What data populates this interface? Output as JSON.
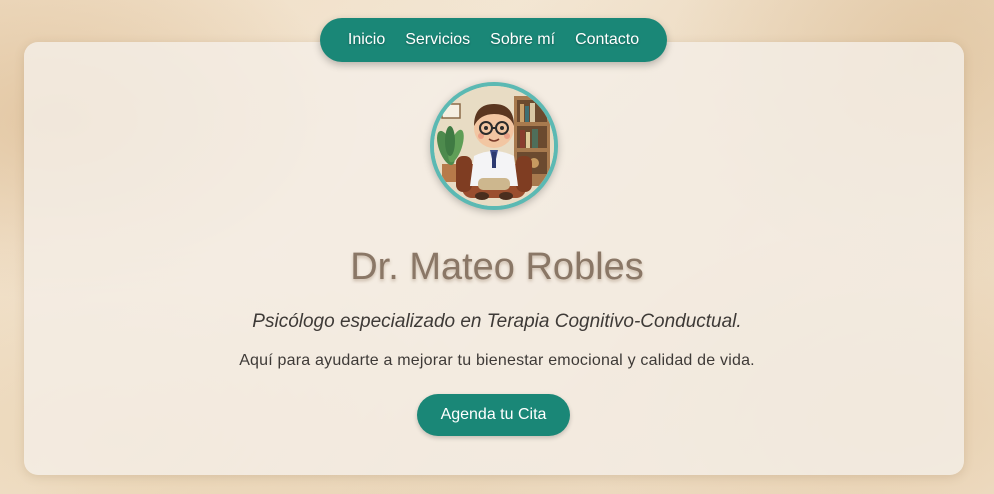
{
  "nav": {
    "items": [
      {
        "label": "Inicio"
      },
      {
        "label": "Servicios"
      },
      {
        "label": "Sobre mí"
      },
      {
        "label": "Contacto"
      }
    ]
  },
  "hero": {
    "name": "Dr. Mateo Robles",
    "subtitle": "Psicólogo especializado en Terapia Cognitivo-Conductual.",
    "tagline": "Aquí para ayudarte a mejorar tu bienestar emocional y calidad de vida.",
    "cta_label": "Agenda tu Cita"
  },
  "colors": {
    "accent": "#1a8777",
    "avatar_ring": "#5bb9b3",
    "title": "#8a7766"
  },
  "avatar": {
    "icon": "psychologist-avatar-illustration"
  }
}
